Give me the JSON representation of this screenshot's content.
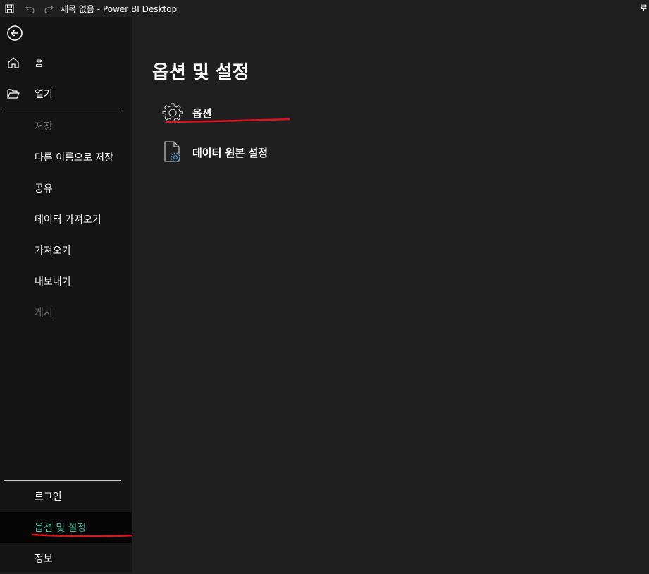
{
  "titlebar": {
    "title": "제목 없음 - Power BI Desktop",
    "right_text": "로",
    "icons": [
      "save-icon",
      "undo-icon",
      "redo-icon"
    ]
  },
  "sidebar": {
    "back_icon": "back-arrow-icon",
    "items": [
      {
        "label": "홈",
        "icon": "home-icon",
        "disabled": false
      },
      {
        "label": "열기",
        "icon": "folder-open-icon",
        "disabled": false
      },
      {
        "label": "저장",
        "disabled": true
      },
      {
        "label": "다른 이름으로 저장",
        "disabled": false
      },
      {
        "label": "공유",
        "disabled": false
      },
      {
        "label": "데이터 가져오기",
        "disabled": false
      },
      {
        "label": "가져오기",
        "disabled": false
      },
      {
        "label": "내보내기",
        "disabled": false
      },
      {
        "label": "게시",
        "disabled": true
      }
    ],
    "bottom_items": [
      {
        "label": "로그인",
        "selected": false
      },
      {
        "label": "옵션 및 설정",
        "selected": true
      },
      {
        "label": "정보",
        "selected": false
      }
    ]
  },
  "main": {
    "title": "옵션 및 설정",
    "options": [
      {
        "label": "옵션",
        "icon": "gear-icon"
      },
      {
        "label": "데이터 원본 설정",
        "icon": "document-settings-icon"
      }
    ]
  },
  "colors": {
    "background": "#1f1f1f",
    "sidebar": "#141414",
    "selected_text": "#3fb9a0",
    "annotation_red": "#e0101e",
    "disabled_text": "#6b6b6b"
  }
}
